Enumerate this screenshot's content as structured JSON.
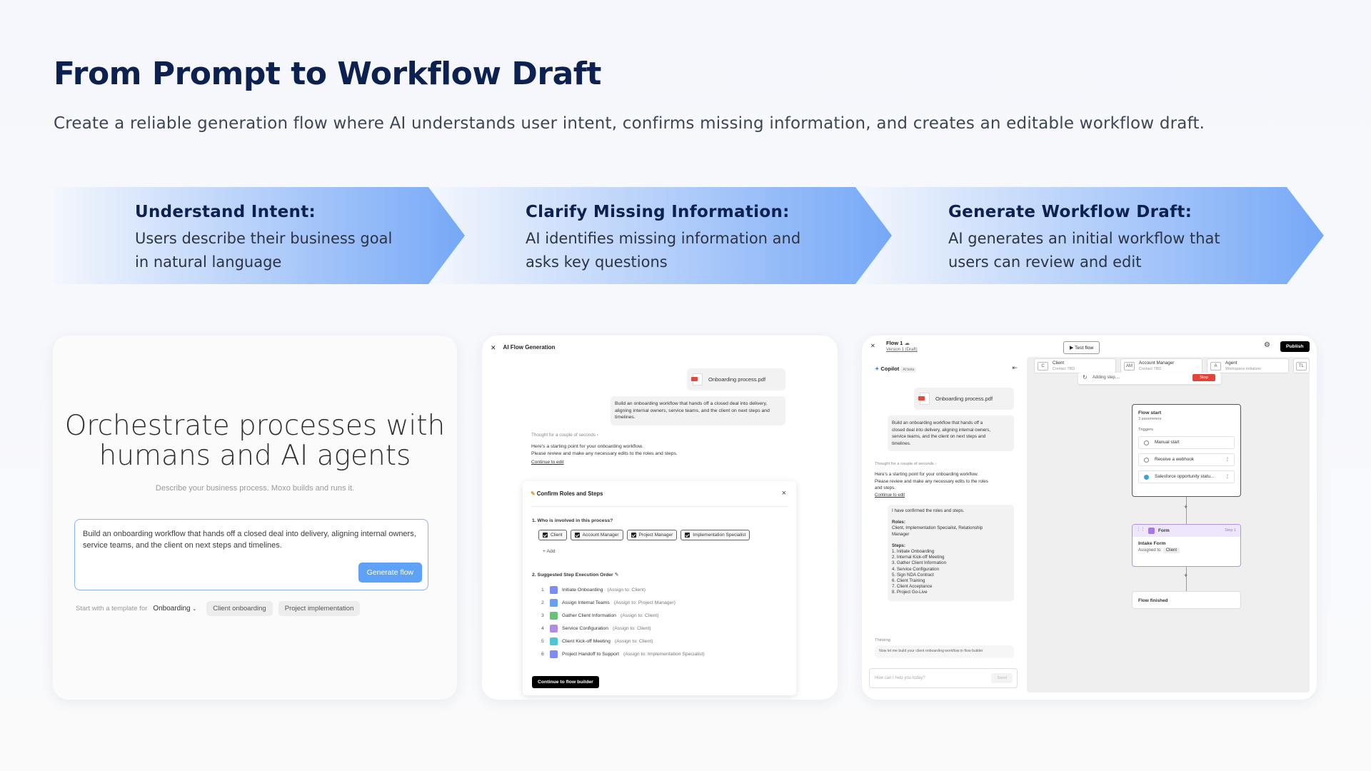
{
  "header": {
    "title": "From Prompt to Workflow Draft",
    "subtitle": "Create a reliable generation flow where AI understands user intent, confirms missing information, and creates an editable workflow draft."
  },
  "stages": [
    {
      "title": "Understand Intent:",
      "line1": "Users describe their business goal",
      "line2": "in natural language"
    },
    {
      "title": "Clarify Missing Information:",
      "line1": "AI identifies missing information and",
      "line2": "asks key questions"
    },
    {
      "title": "Generate Workflow Draft:",
      "line1": "AI generates an initial workflow that",
      "line2": "users can review and edit"
    }
  ],
  "colors": {
    "accent": "#5da2f7",
    "title": "#0d2150",
    "chevron_start": "#f4f7fd",
    "chevron_end": "#76a8f7"
  },
  "card1": {
    "hero_line1": "Orchestrate processes with",
    "hero_line2": "humans and AI agents",
    "sub": "Describe your business process. Moxo builds and runs it.",
    "prompt": "Build an onboarding workflow that hands off a closed deal into delivery, aligning internal owners, service teams, and the client on next steps and timelines.",
    "generate_label": "Generate flow",
    "template_label": "Start with a template for",
    "template_selected": "Onboarding",
    "templates": [
      "Client onboarding",
      "Project implementation"
    ]
  },
  "card2": {
    "window_title": "AI Flow Generation",
    "file_name": "Onboarding process.pdf",
    "prompt_lines": [
      "Build an onboarding workflow that hands off a closed deal into delivery,",
      "aligning internal owners, service teams, and the client on next steps and",
      "timelines."
    ],
    "thought": "Thought for a couple of seconds",
    "reply_line1": "Here's a starting point for your onboarding workflow.",
    "reply_line2": "Please review and make any necessary edits to the roles and steps.",
    "continue_edit": "Continue to edit",
    "panel_title": "Confirm Roles and Steps",
    "q1": "1. Who is involved in this process?",
    "roles": [
      "Client",
      "Account Manager",
      "Project Manager",
      "Implementation Specialist"
    ],
    "add_label": "+  Add",
    "q2": "2. Suggested Step Execution Order",
    "steps": [
      {
        "name": "Initiate Onboarding",
        "assign": "(Assign to: Client)",
        "color": "#7b8df0"
      },
      {
        "name": "Assign Internal Teams",
        "assign": "(Assign to: Project Manager)",
        "color": "#6a9ef0"
      },
      {
        "name": "Gather Client Information",
        "assign": "(Assign to: Client)",
        "color": "#6cbf7a"
      },
      {
        "name": "Service Configuration",
        "assign": "(Assign to: Client)",
        "color": "#b18be8"
      },
      {
        "name": "Client Kick-off Meeting",
        "assign": "(Assign to: Client)",
        "color": "#4fc6d6"
      },
      {
        "name": "Project Handoff to Support",
        "assign": "(Assign to: Implementation Specialist)",
        "color": "#7b8df0"
      }
    ],
    "continue_builder": "Continue to flow builder"
  },
  "card3": {
    "flow_name": "Flow 1",
    "version": "Version 1 (Draft)",
    "test_flow": "Test flow",
    "publish": "Publish",
    "copilot": "Copilot",
    "beta": "AI beta",
    "file_name": "Onboarding process.pdf",
    "prompt_lines": [
      "Build an onboarding workflow that hands off a",
      "closed deal into delivery, aligning internal owners,",
      "service teams, and the client on next steps and",
      "timelines."
    ],
    "thought": "Thought for a couple of seconds",
    "reply_lines": [
      "Here's a starting point for your onboarding workflow.",
      "Please review and make any necessary edits to the roles",
      "and steps."
    ],
    "continue_edit": "Continue to edit",
    "confirm_text": "I have confirmed the roles and steps.",
    "roles_label": "Roles:",
    "roles_value": [
      "Client, Implementation Specialist, Relationship",
      "Manager"
    ],
    "steps_label": "Steps:",
    "steps_list": [
      "1. Initiate Onboarding",
      "2. Internal Kick-off Meeting",
      "3. Gather Client Information",
      "4. Service Configuration",
      "5. Sign NDA Contract",
      "6. Client Training",
      "7. Client Acceptance",
      "8. Project Go-Live"
    ],
    "thinking_label": "Thinking",
    "thinking_text": "Now let me build your client onboarding workflow in flow builder",
    "input_placeholder": "How can I help you today?",
    "send": "Send",
    "role_cards": [
      {
        "avatar": "C",
        "name": "Client",
        "sub": "Contact TBD"
      },
      {
        "avatar": "AM",
        "name": "Account Manager",
        "sub": "Contact TBD"
      },
      {
        "avatar": "A",
        "name": "Agent",
        "sub": "Workspace initializer"
      },
      {
        "avatar": "TL",
        "name": "",
        "sub": ""
      }
    ],
    "adding": "Adding step....",
    "stop": "Stop",
    "flow_start": "Flow start",
    "params": "3 parameters",
    "triggers_label": "Triggers",
    "triggers": [
      "Manual start",
      "Receive a webhook",
      "Salesforce opportunity statu..."
    ],
    "form_label": "Form",
    "step_tag": "Step 1",
    "form_title": "Intake Form",
    "assigned_label": "Assigned to:",
    "assigned_value": "Client",
    "flow_finished": "Flow finished"
  }
}
